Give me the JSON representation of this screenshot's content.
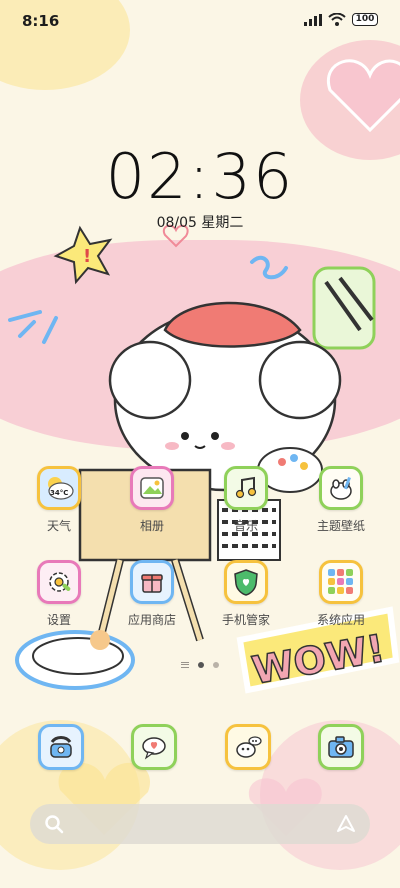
{
  "status_bar": {
    "time": "8:16",
    "battery": "100",
    "icons": [
      "signal-icon",
      "wifi-icon",
      "battery-icon"
    ]
  },
  "lock_clock": {
    "time": "02:36",
    "date": "08/05 星期二"
  },
  "apps": [
    {
      "label": "天气",
      "icon": "weather-icon",
      "badge": "34°C",
      "color": "#f6c23e"
    },
    {
      "label": "相册",
      "icon": "gallery-icon",
      "color": "#e879b9"
    },
    {
      "label": "音乐",
      "icon": "music-icon",
      "color": "#8fd15a"
    },
    {
      "label": "主题壁纸",
      "icon": "theme-icon",
      "color": "#8fd15a"
    },
    {
      "label": "设置",
      "icon": "settings-icon",
      "color": "#e879b9"
    },
    {
      "label": "应用商店",
      "icon": "app-store-icon",
      "color": "#6fb6f2"
    },
    {
      "label": "手机管家",
      "icon": "security-icon",
      "color": "#f6c23e"
    },
    {
      "label": "系统应用",
      "icon": "folder-icon",
      "color": "#f6c23e"
    }
  ],
  "dock": [
    {
      "icon": "phone-icon",
      "color": "#6fb6f2"
    },
    {
      "icon": "messages-icon",
      "color": "#8fd15a"
    },
    {
      "icon": "browser-icon",
      "color": "#f6c23e"
    },
    {
      "icon": "camera-icon",
      "color": "#8fd15a"
    }
  ],
  "pager": {
    "pages": 2,
    "active": 1
  },
  "search": {
    "placeholder": ""
  },
  "wallpaper": {
    "text": "WOW!"
  }
}
